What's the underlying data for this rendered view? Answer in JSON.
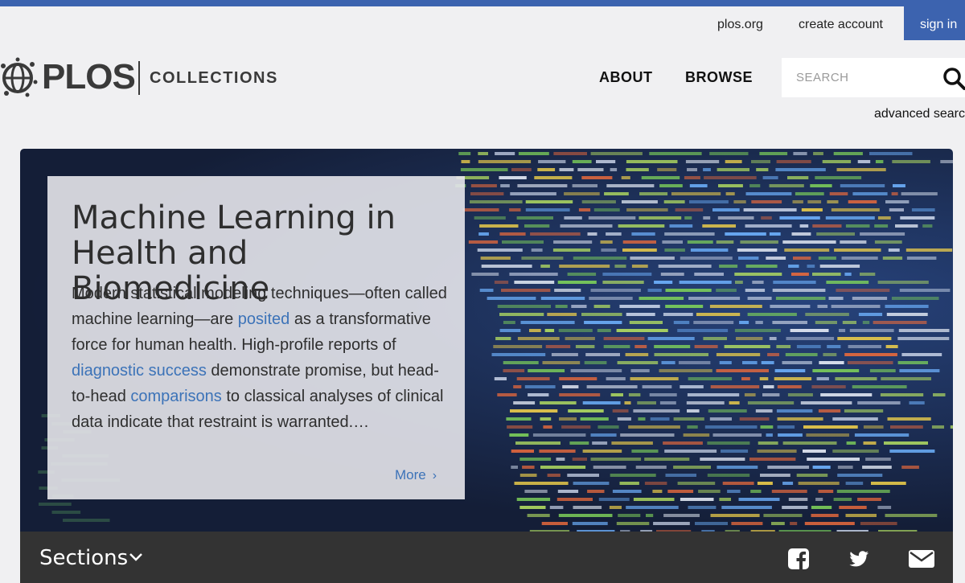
{
  "utility_nav": {
    "plos_org": "plos.org",
    "create_account": "create account",
    "sign_in": "sign in"
  },
  "brand": {
    "logo_text": "PLOS",
    "collections": "COLLECTIONS"
  },
  "main_nav": {
    "about": "ABOUT",
    "browse": "BROWSE"
  },
  "search": {
    "placeholder": "SEARCH",
    "advanced": "advanced search"
  },
  "hero": {
    "title": "Machine Learning in Health and Biomedicine",
    "body_parts": [
      "Modern statistical modeling techniques—often called machine learning—are ",
      "posited",
      " as a transformative force for human health. High-profile reports of ",
      "diagnostic success",
      " demonstrate promise, but head-to-head ",
      "comparisons",
      " to classical analyses of clinical data indicate that restraint is warranted.…"
    ],
    "more": "More",
    "more_chevron": "›"
  },
  "sections_bar": {
    "label": "Sections",
    "icons": [
      "facebook-icon",
      "twitter-icon",
      "email-icon"
    ]
  },
  "colors": {
    "brand_blue": "#3c63af",
    "link_blue": "#3c73b8",
    "dark_bar": "#333333"
  }
}
